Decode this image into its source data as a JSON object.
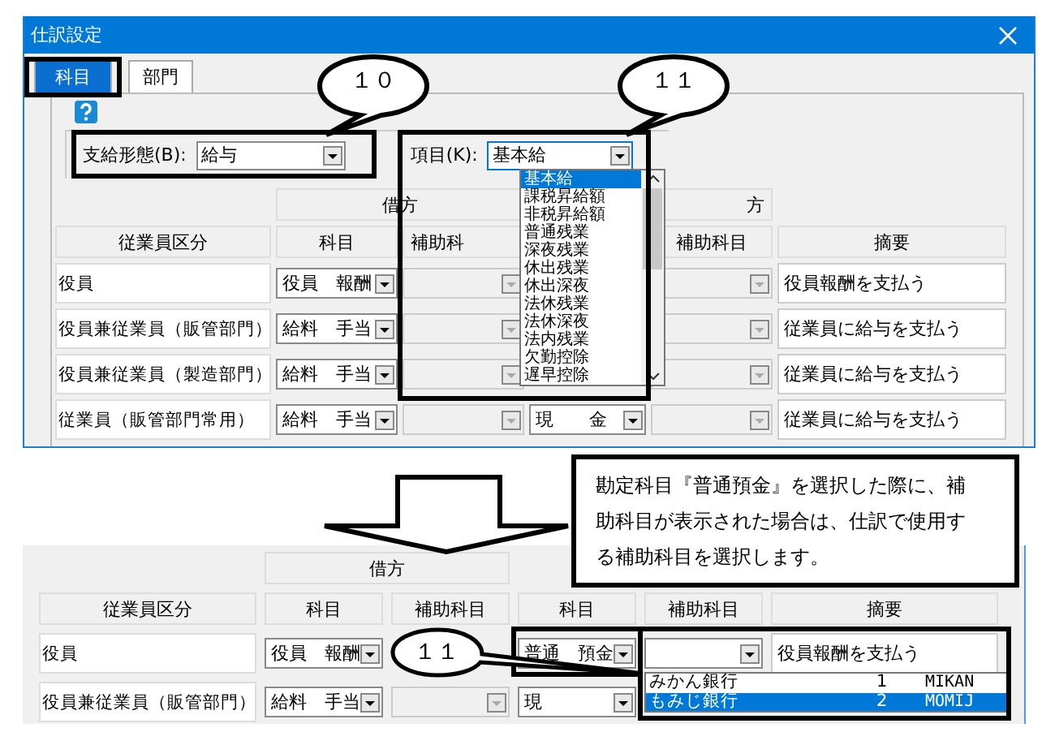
{
  "window": {
    "title": "仕訳設定"
  },
  "tabs": [
    {
      "label": "科目",
      "selected": true
    },
    {
      "label": "部門",
      "selected": false
    }
  ],
  "payment_type": {
    "label": "支給形態(B):",
    "value": "給与"
  },
  "item_select": {
    "label": "項目(K):",
    "value": "基本給",
    "expanded": true,
    "options": [
      {
        "label": "基本給",
        "selected": true
      },
      {
        "label": "課税昇給額",
        "selected": false
      },
      {
        "label": "非税昇給額",
        "selected": false
      },
      {
        "label": "普通残業",
        "selected": false
      },
      {
        "label": "深夜残業",
        "selected": false
      },
      {
        "label": "休出残業",
        "selected": false
      },
      {
        "label": "休出深夜",
        "selected": false
      },
      {
        "label": "法休残業",
        "selected": false
      },
      {
        "label": "法休深夜",
        "selected": false
      },
      {
        "label": "法内残業",
        "selected": false
      },
      {
        "label": "欠勤控除",
        "selected": false
      },
      {
        "label": "遅早控除",
        "selected": false
      }
    ]
  },
  "table": {
    "groups": [
      "借方",
      "方"
    ],
    "columns": [
      "従業員区分",
      "科目",
      "補助科",
      null,
      "補助科目",
      "摘要"
    ],
    "rows": [
      {
        "cells": [
          {
            "kind": "label",
            "text": "役員"
          },
          {
            "kind": "combo",
            "text": "役員　報酬",
            "disabled": false
          },
          {
            "kind": "combo",
            "disabled": true
          },
          null,
          {
            "kind": "combo",
            "disabled": true
          },
          {
            "kind": "text",
            "text": "役員報酬を支払う"
          }
        ]
      },
      {
        "cells": [
          {
            "kind": "label",
            "text": "役員兼従業員（販管部門）"
          },
          {
            "kind": "combo",
            "text": "給料　手当",
            "disabled": false
          },
          {
            "kind": "combo",
            "disabled": true
          },
          null,
          {
            "kind": "combo",
            "disabled": true
          },
          {
            "kind": "text",
            "text": "従業員に給与を支払う"
          }
        ]
      },
      {
        "cells": [
          {
            "kind": "label",
            "text": "役員兼従業員（製造部門）"
          },
          {
            "kind": "combo",
            "text": "給料　手当",
            "disabled": false
          },
          {
            "kind": "combo",
            "disabled": true
          },
          null,
          {
            "kind": "combo",
            "disabled": true
          },
          {
            "kind": "text",
            "text": "従業員に給与を支払う"
          }
        ]
      },
      {
        "cells": [
          {
            "kind": "label",
            "text": "従業員（販管部門常用）"
          },
          {
            "kind": "combo",
            "text": "給料　手当",
            "disabled": false
          },
          {
            "kind": "combo",
            "disabled": true
          },
          {
            "kind": "combo",
            "text": "現　　金",
            "disabled": false
          },
          {
            "kind": "combo",
            "disabled": true
          },
          {
            "kind": "text",
            "text": "従業員に給与を支払う"
          }
        ]
      }
    ]
  },
  "example": {
    "groups": [
      "借方"
    ],
    "columns": [
      "従業員区分",
      "科目",
      "補助科目",
      "科目",
      "補助科目",
      "摘要"
    ],
    "rows": [
      {
        "cells": [
          {
            "kind": "label",
            "text": "役員"
          },
          {
            "kind": "combo",
            "text": "役員　報酬",
            "disabled": false
          },
          null,
          {
            "kind": "combo",
            "text": "普通　預金",
            "disabled": false
          },
          {
            "kind": "combo",
            "disabled": false
          },
          {
            "kind": "text",
            "text": "役員報酬を支払う"
          }
        ]
      },
      {
        "cells": [
          {
            "kind": "label",
            "text": "役員兼従業員（販管部門）"
          },
          {
            "kind": "combo",
            "text": "給料　手当",
            "disabled": false
          },
          {
            "kind": "combo",
            "disabled": true
          },
          {
            "kind": "combo",
            "text": "現",
            "disabled": false
          },
          null,
          null
        ]
      }
    ],
    "sub_account_list": [
      {
        "name": "みかん銀行",
        "number": "1",
        "code": "MIKAN",
        "selected": false
      },
      {
        "name": "もみじ銀行",
        "number": "2",
        "code": "MOMIJ",
        "selected": true
      }
    ]
  },
  "bubbles": [
    "１０",
    "１１",
    "１１"
  ],
  "note": "勘定科目『普通預金』を選択した際に、補助科目が表示された場合は、仕訳で使用する補助科目を選択します。"
}
